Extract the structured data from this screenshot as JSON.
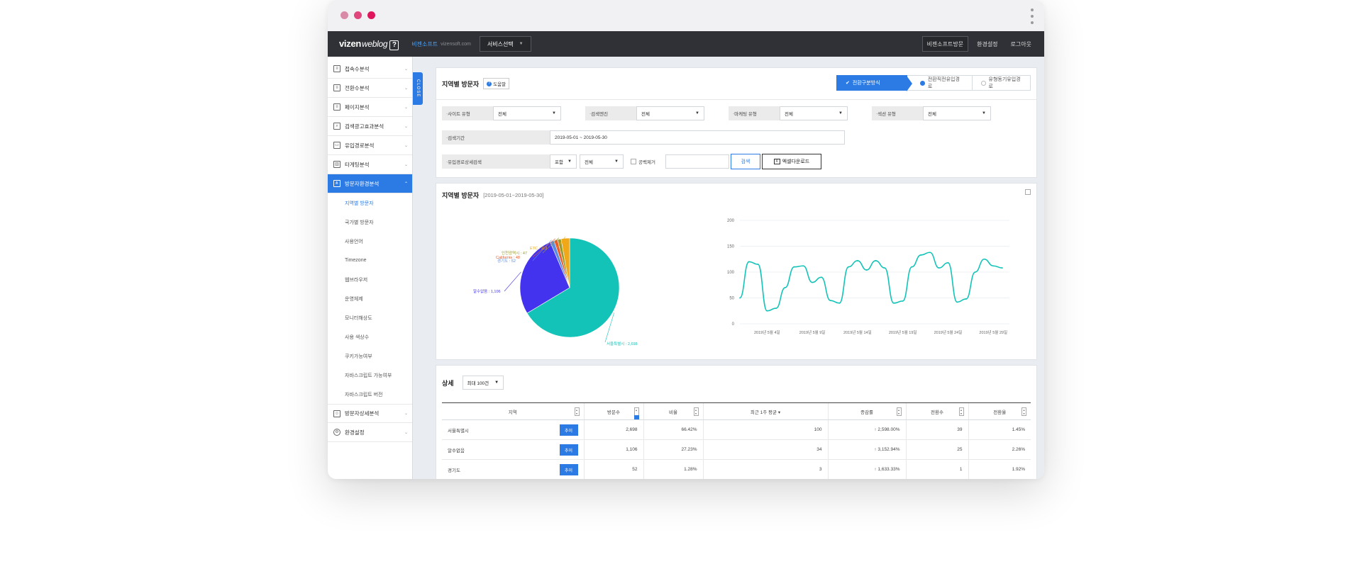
{
  "chrome": {
    "dot_colors": [
      "#d98aa6",
      "#e0467c",
      "#e0165c"
    ]
  },
  "topnav": {
    "logo": "vizen",
    "logo_sub": "weblog",
    "logo_mark": "?",
    "company": "비젠소프트",
    "company_url": "vizensoft.com",
    "service_select": "서비스선택",
    "right_buttons": [
      "비젠소프트방문",
      "환경설정",
      "로그아웃"
    ]
  },
  "sidebar": {
    "items": [
      {
        "label": "접속수분석",
        "icon": "report-icon"
      },
      {
        "label": "전환수분석",
        "icon": "report-icon"
      },
      {
        "label": "페이지분석",
        "icon": "report-icon"
      },
      {
        "label": "검색광고효과분석",
        "icon": "search-report-icon"
      },
      {
        "label": "유입경로분석",
        "icon": "monitor-icon"
      },
      {
        "label": "타게팅분석",
        "icon": "bar-chart-icon"
      },
      {
        "label": "방문자환경분석",
        "icon": "network-icon"
      }
    ],
    "sub_items": [
      "지역별 방문자",
      "국가별 방문자",
      "사용언어",
      "Timezone",
      "웹브라우저",
      "운영체제",
      "모니터해상도",
      "사용 색상수",
      "쿠키가능여부",
      "자바스크립트 가능여부",
      "자바스크립트 버전"
    ],
    "bottom_items": [
      {
        "label": "방문자상세분석",
        "icon": "user-search-icon"
      },
      {
        "label": "환경설정",
        "icon": "gear-icon"
      }
    ],
    "close_tab": "CLOSE"
  },
  "filter_panel": {
    "title": "지역별 방문자",
    "help": "도움말",
    "steps": [
      "전환구분방식",
      "전환직전유입경로",
      "유형동기유입경로"
    ],
    "row1": [
      {
        "label": "사이트 유형",
        "value": "전체"
      },
      {
        "label": "검색엔진",
        "value": "전체"
      },
      {
        "label": "마케팅 유형",
        "value": "전체"
      },
      {
        "label": "섹션 유형",
        "value": "전체"
      }
    ],
    "period_label": "검색기간",
    "period_value": "2019-05-01 ~ 2019-05-30",
    "detail_label": "유입경로상세검색",
    "detail_sel1": "포함",
    "detail_sel2": "전체",
    "exclude_blank": "공백제거",
    "search_button": "검색",
    "excel_button": "엑셀다운로드"
  },
  "chart_panel": {
    "title": "지역별 방문자",
    "date_range": "[2019-05-01~2019-05-30]"
  },
  "chart_data": [
    {
      "type": "pie",
      "title": "",
      "slices": [
        {
          "label": "서울특별시",
          "value": 2698,
          "color": "#14c3b8",
          "text": "서울특별시 : 2,698"
        },
        {
          "label": "알수없음",
          "value": 1106,
          "color": "#4433ee",
          "text": "알수없음 : 1,106"
        },
        {
          "label": "경기도",
          "value": 52,
          "color": "#5b8de0",
          "text": "경기도 : 52"
        },
        {
          "label": "California",
          "value": 48,
          "color": "#ea5c2a",
          "text": "California : 48"
        },
        {
          "label": "인천광역시",
          "value": 47,
          "color": "#9b9b2a",
          "text": "인천광역시 : 47"
        },
        {
          "label": "ETC",
          "value": 113,
          "color": "#f0a818",
          "text": "ETC : 113"
        }
      ]
    },
    {
      "type": "line",
      "title": "",
      "xlabel": "",
      "ylabel": "",
      "ylim": [
        0,
        200
      ],
      "yticks": [
        0,
        50,
        100,
        150,
        200
      ],
      "xtick_labels": [
        "2019년 5월 4일",
        "2019년 5월 9일",
        "2019년 5월 14일",
        "2019년 5월 19일",
        "2019년 5월 24일",
        "2019년 5월 29일"
      ],
      "line_color": "#14c3b8",
      "series": [
        {
          "values": [
            50,
            120,
            115,
            25,
            30,
            70,
            110,
            112,
            80,
            90,
            45,
            40,
            110,
            122,
            104,
            122,
            108,
            40,
            44,
            110,
            133,
            138,
            108,
            118,
            42,
            48,
            100,
            125,
            112,
            108
          ]
        }
      ]
    }
  ],
  "detail_panel": {
    "title": "상세",
    "count_select": "최대 100건",
    "columns": [
      "지역",
      "방문수",
      "비율",
      "최근 1주 평균",
      "증감률",
      "전환수",
      "전환율"
    ],
    "trend_button": "추이",
    "rows": [
      {
        "region": "서울특별시",
        "visits": "2,698",
        "ratio": "66.42%",
        "avg": "100",
        "change": "2,598.00%",
        "conv": "39",
        "conv_rate": "1.45%"
      },
      {
        "region": "알수없음",
        "visits": "1,106",
        "ratio": "27.23%",
        "avg": "34",
        "change": "3,152.94%",
        "conv": "25",
        "conv_rate": "2.26%"
      },
      {
        "region": "경기도",
        "visits": "52",
        "ratio": "1.28%",
        "avg": "3",
        "change": "1,633.33%",
        "conv": "1",
        "conv_rate": "1.92%"
      }
    ]
  }
}
